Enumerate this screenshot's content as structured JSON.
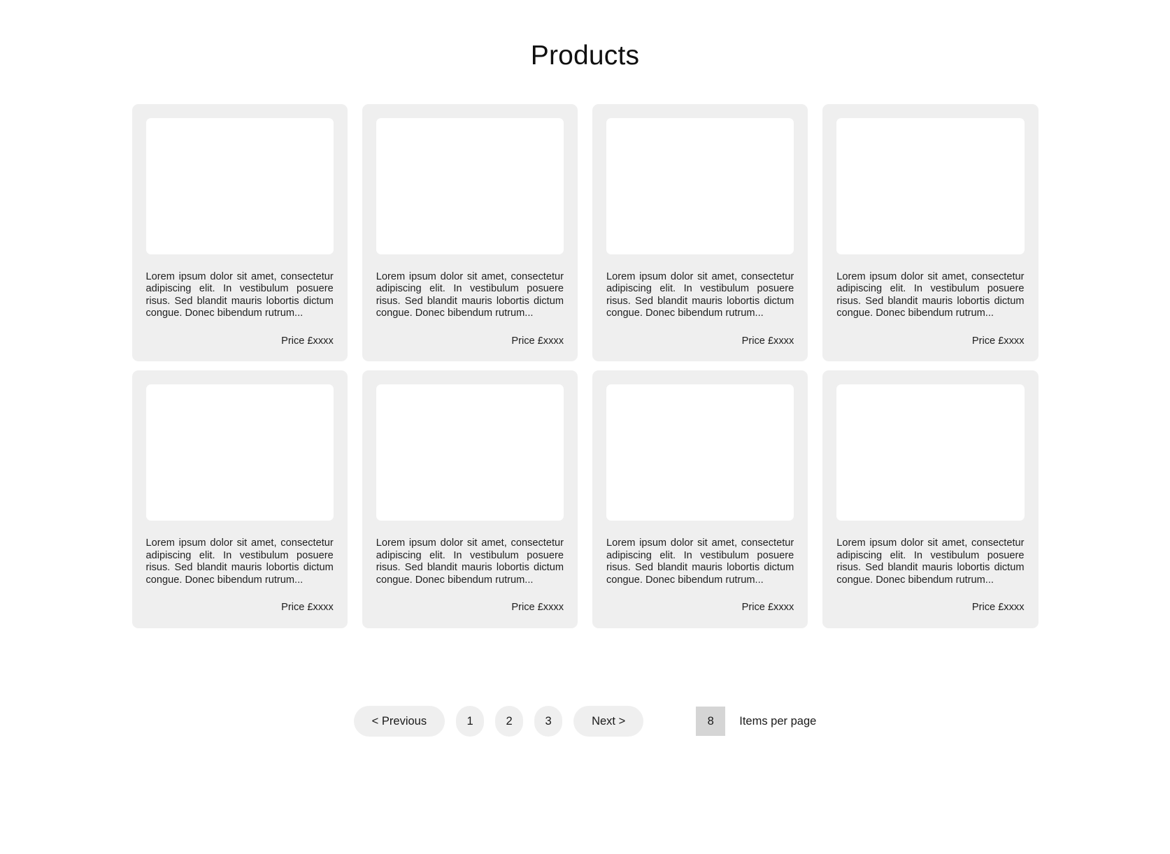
{
  "header": {
    "title": "Products"
  },
  "products": [
    {
      "description": "Lorem ipsum dolor sit amet, consectetur adipiscing elit. In vestibulum posuere risus. Sed blandit mauris lobortis dictum congue. Donec bibendum rutrum...",
      "price": "Price £xxxx"
    },
    {
      "description": "Lorem ipsum dolor sit amet, consectetur adipiscing elit. In vestibulum posuere risus. Sed blandit mauris lobortis dictum congue. Donec bibendum rutrum...",
      "price": "Price £xxxx"
    },
    {
      "description": "Lorem ipsum dolor sit amet, consectetur adipiscing elit. In vestibulum posuere risus. Sed blandit mauris lobortis dictum congue. Donec bibendum rutrum...",
      "price": "Price £xxxx"
    },
    {
      "description": "Lorem ipsum dolor sit amet, consectetur adipiscing elit. In vestibulum posuere risus. Sed blandit mauris lobortis dictum congue. Donec bibendum rutrum...",
      "price": "Price £xxxx"
    },
    {
      "description": "Lorem ipsum dolor sit amet, consectetur adipiscing elit. In vestibulum posuere risus. Sed blandit mauris lobortis dictum congue. Donec bibendum rutrum...",
      "price": "Price £xxxx"
    },
    {
      "description": "Lorem ipsum dolor sit amet, consectetur adipiscing elit. In vestibulum posuere risus. Sed blandit mauris lobortis dictum congue. Donec bibendum rutrum...",
      "price": "Price £xxxx"
    },
    {
      "description": "Lorem ipsum dolor sit amet, consectetur adipiscing elit. In vestibulum posuere risus. Sed blandit mauris lobortis dictum congue. Donec bibendum rutrum...",
      "price": "Price £xxxx"
    },
    {
      "description": "Lorem ipsum dolor sit amet, consectetur adipiscing elit. In vestibulum posuere risus. Sed blandit mauris lobortis dictum congue. Donec bibendum rutrum...",
      "price": "Price £xxxx"
    }
  ],
  "pagination": {
    "previous_label": "< Previous",
    "next_label": "Next >",
    "pages": [
      "1",
      "2",
      "3"
    ],
    "items_per_page_value": "8",
    "items_per_page_label": "Items per page"
  },
  "colors": {
    "card_background": "#efefef",
    "image_placeholder": "#ffffff",
    "button_background": "#efefef",
    "input_background": "#d5d5d5",
    "page_background": "#ffffff",
    "text": "#1a1a1a"
  }
}
